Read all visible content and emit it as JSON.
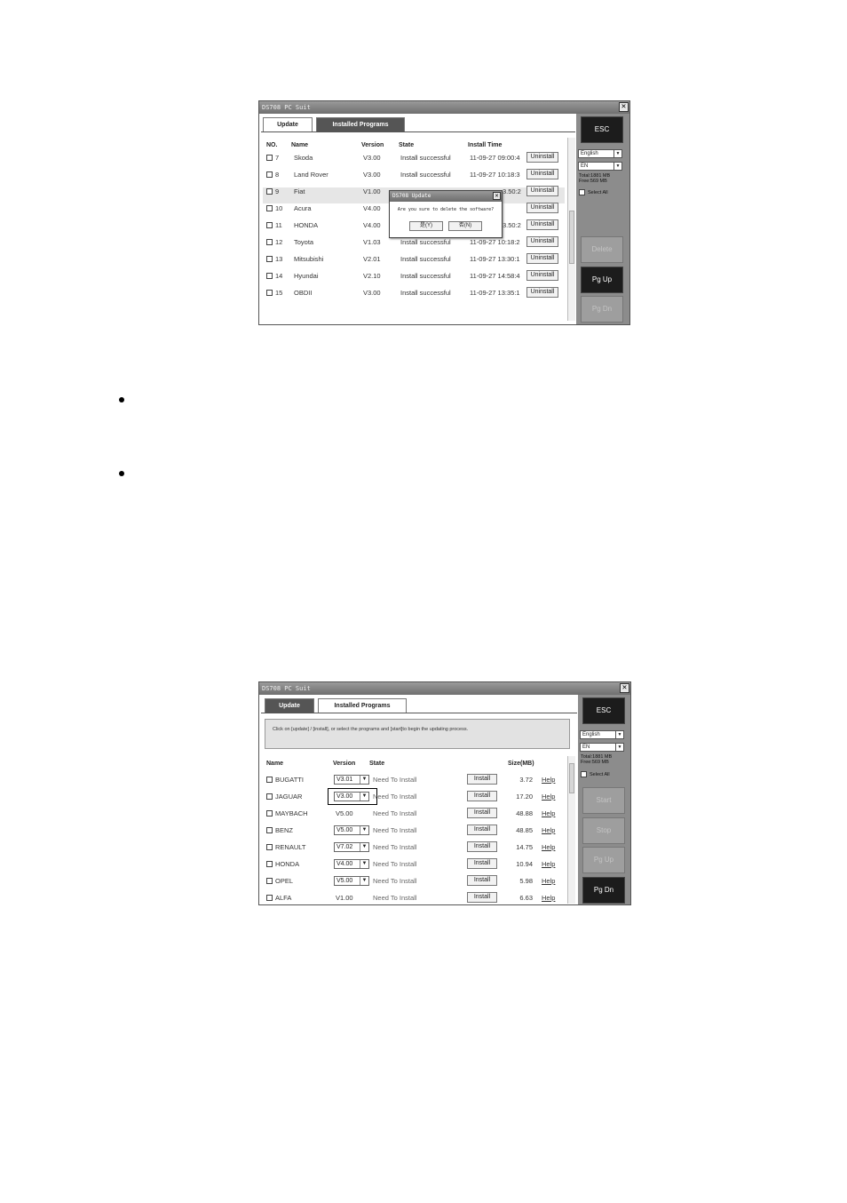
{
  "screenshot1": {
    "window_title": "DS708 PC Suit",
    "close_glyph": "✕",
    "tabs": [
      "Update",
      "Installed Programs"
    ],
    "columns": [
      "NO.",
      "Name",
      "Version",
      "State",
      "Install Time"
    ],
    "rows": [
      {
        "no": "7",
        "name": "Skoda",
        "version": "V3.00",
        "state": "Install successful",
        "time": "11-09-27 09:00:4",
        "action": "Uninstall"
      },
      {
        "no": "8",
        "name": "Land Rover",
        "version": "V3.00",
        "state": "Install successful",
        "time": "11-09-27 10:18:3",
        "action": "Uninstall"
      },
      {
        "no": "9",
        "name": "Fiat",
        "version": "V1.00",
        "state": "",
        "time": "3.50:2",
        "action": "Uninstall"
      },
      {
        "no": "10",
        "name": "Acura",
        "version": "V4.00",
        "state": "",
        "time": "",
        "action": "Uninstall"
      },
      {
        "no": "11",
        "name": "HONDA",
        "version": "V4.00",
        "state": "",
        "time": "3.50:2",
        "action": "Uninstall"
      },
      {
        "no": "12",
        "name": "Toyota",
        "version": "V1.03",
        "state": "Install successful",
        "time": "11-09-27 10:18:2",
        "action": "Uninstall"
      },
      {
        "no": "13",
        "name": "Mitsubishi",
        "version": "V2.01",
        "state": "Install successful",
        "time": "11-09-27 13:30:1",
        "action": "Uninstall"
      },
      {
        "no": "14",
        "name": "Hyundai",
        "version": "V2.10",
        "state": "Install successful",
        "time": "11-09-27 14:58:4",
        "action": "Uninstall"
      },
      {
        "no": "15",
        "name": "OBDII",
        "version": "V3.00",
        "state": "Install successful",
        "time": "11-09-27 13:35:1",
        "action": "Uninstall"
      }
    ],
    "dialog": {
      "title": "DS708 Update",
      "message": "Are you sure to delete the software?",
      "yes": "是(Y)",
      "no": "否(N)"
    },
    "side": {
      "esc": "ESC",
      "language": "English",
      "region": "EN",
      "total": "Total:1881 MB",
      "free": "Free:569 MB",
      "select_all": "Select All",
      "buttons": [
        "Delete",
        "Pg Up",
        "Pg Dn"
      ]
    }
  },
  "screenshot2": {
    "window_title": "DS708 PC Suit",
    "close_glyph": "✕",
    "tabs": [
      "Update",
      "Installed Programs"
    ],
    "notice": "Click on [update] / [install], or select the programs and [start]to begin the updating process.",
    "columns": [
      "Name",
      "Version",
      "State",
      "Size(MB)"
    ],
    "rows": [
      {
        "name": "BUGATTI",
        "version": "V3.01",
        "dropdown": true,
        "state": "Need To Install",
        "action": "Install",
        "size": "3.72",
        "help": "Help"
      },
      {
        "name": "JAGUAR",
        "version": "V3.00",
        "dropdown": true,
        "state": "Need To Install",
        "action": "Install",
        "size": "17.20",
        "help": "Help"
      },
      {
        "name": "MAYBACH",
        "version": "V5.00",
        "dropdown": false,
        "state": "Need To Install",
        "action": "Install",
        "size": "48.88",
        "help": "Help"
      },
      {
        "name": "BENZ",
        "version": "V5.00",
        "dropdown": true,
        "state": "Need To Install",
        "action": "Install",
        "size": "48.85",
        "help": "Help"
      },
      {
        "name": "RENAULT",
        "version": "V7.02",
        "dropdown": true,
        "state": "Need To Install",
        "action": "Install",
        "size": "14.75",
        "help": "Help"
      },
      {
        "name": "HONDA",
        "version": "V4.00",
        "dropdown": true,
        "state": "Need To Install",
        "action": "Install",
        "size": "10.94",
        "help": "Help"
      },
      {
        "name": "OPEL",
        "version": "V5.00",
        "dropdown": true,
        "state": "Need To Install",
        "action": "Install",
        "size": "5.98",
        "help": "Help"
      },
      {
        "name": "ALFA",
        "version": "V1.00",
        "dropdown": false,
        "state": "Need To Install",
        "action": "Install",
        "size": "6.63",
        "help": "Help"
      }
    ],
    "side": {
      "esc": "ESC",
      "language": "English",
      "region": "EN",
      "total": "Total:1881 MB",
      "free": "Free:569 MB",
      "select_all": "Select All",
      "buttons": [
        "Start",
        "Stop",
        "Pg Up",
        "Pg Dn"
      ]
    }
  }
}
